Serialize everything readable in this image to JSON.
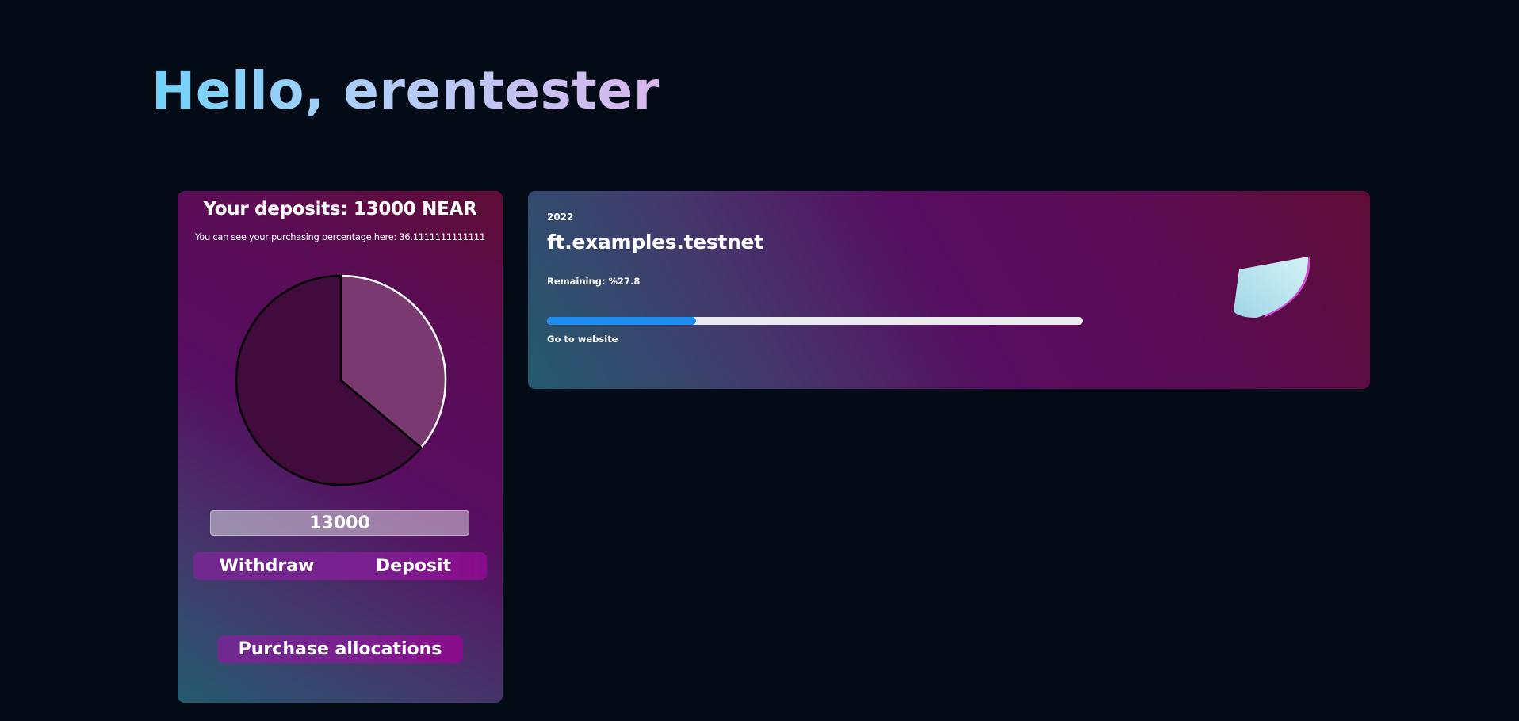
{
  "greeting": "Hello, erentester",
  "deposit_card": {
    "title": "Your deposits: 13000 NEAR",
    "subtitle": "You can see your purchasing percentage here: 36.1111111111111",
    "amount_value": "13000",
    "withdraw_label": "Withdraw",
    "deposit_label": "Deposit",
    "purchase_label": "Purchase allocations"
  },
  "project_card": {
    "year": "2022",
    "name": "ft.examples.testnet",
    "remaining": "Remaining: %27.8",
    "progress_fraction": 0.278,
    "link_text": "Go to website",
    "logo_icon": "cone-logo-icon"
  },
  "chart_data": {
    "type": "pie",
    "values": [
      36.1111111111111,
      63.8888888888889
    ],
    "colors": [
      "#7a3a71",
      "#420b3d"
    ]
  }
}
